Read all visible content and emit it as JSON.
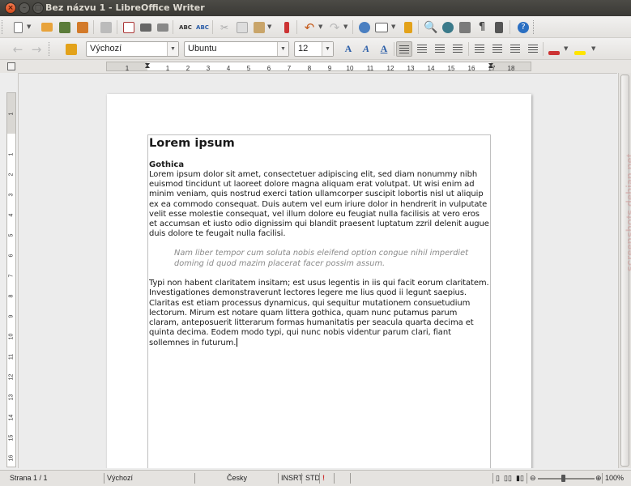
{
  "window": {
    "title": "Bez názvu 1 - LibreOffice Writer"
  },
  "formatting": {
    "paragraph_style": "Výchozí",
    "font_name": "Ubuntu",
    "font_size": "12"
  },
  "ruler": {
    "ticks": [
      "1",
      "1",
      "2",
      "3",
      "4",
      "5",
      "6",
      "7",
      "8",
      "9",
      "10",
      "11",
      "12",
      "13",
      "14",
      "15",
      "16",
      "17",
      "18"
    ],
    "vertical_ticks": [
      "1",
      "1",
      "2",
      "3",
      "4",
      "5",
      "6",
      "7",
      "8",
      "9",
      "10",
      "11",
      "12",
      "13",
      "14",
      "15",
      "16"
    ]
  },
  "document": {
    "heading": "Lorem ipsum",
    "subheading": "Gothica",
    "paragraph1": "Lorem ipsum dolor sit amet, consectetuer adipiscing elit, sed diam nonummy nibh euismod tincidunt ut laoreet dolore magna aliquam erat volutpat. Ut wisi enim ad minim veniam, quis nostrud exerci tation ullamcorper suscipit lobortis nisl ut aliquip ex ea commodo consequat. Duis autem vel eum iriure dolor in hendrerit in vulputate velit esse molestie consequat, vel illum dolore eu feugiat nulla facilisis at vero eros et accumsan et iusto odio dignissim qui blandit praesent luptatum zzril delenit augue duis dolore te feugait nulla facilisi.",
    "quote": "Nam liber tempor cum soluta nobis eleifend option congue nihil imperdiet doming id quod mazim placerat facer possim assum.",
    "paragraph2": "Typi non habent claritatem insitam; est usus legentis in iis qui facit eorum claritatem. Investigationes demonstraverunt lectores legere me lius quod ii legunt saepius. Claritas est etiam processus dynamicus, qui sequitur mutationem consuetudium lectorum. Mirum est notare quam littera gothica, quam nunc putamus parum claram, anteposuerit litterarum formas humanitatis per seacula quarta decima et quinta decima. Eodem modo typi, qui nunc nobis videntur parum clari, fiant sollemnes in futurum."
  },
  "statusbar": {
    "page": "Strana 1 / 1",
    "style": "Výchozí",
    "language": "Česky",
    "insert_mode": "INSRT",
    "selection_mode": "STD",
    "zoom": "100%"
  },
  "watermark": "screenshots.debian.net",
  "colors": {
    "title_bar": "#3c3b37",
    "toolbar": "#ededed",
    "close_button": "#e0582a",
    "format_icon_blue": "#2b5ea8"
  }
}
